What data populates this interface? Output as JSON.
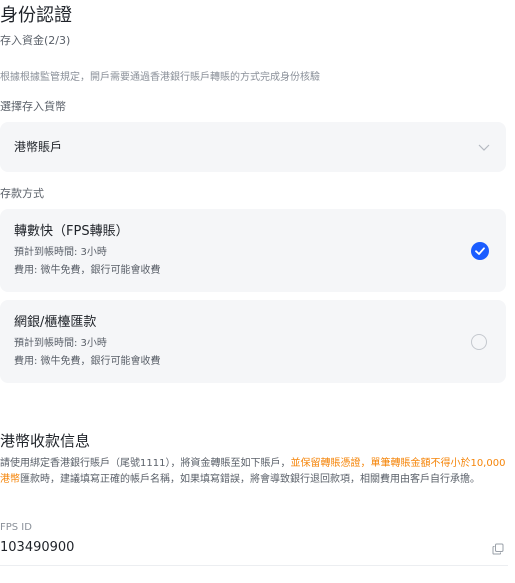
{
  "header": {
    "title": "身份認證",
    "step": "存入資金(2/3)"
  },
  "notice": "根據根據監管規定，開戶需要通過香港銀行賬戶轉賬的方式完成身份核驗",
  "currency": {
    "label": "選擇存入貨幣",
    "selected": "港幣賬戶"
  },
  "deposit_method": {
    "label": "存款方式",
    "options": [
      {
        "title": "轉數快（FPS轉賬）",
        "eta": "預計到帳時間: 3小時",
        "fee": "費用: 微牛免費，銀行可能會收費",
        "selected": true
      },
      {
        "title": "網銀/櫃檯匯款",
        "eta": "預計到帳時間: 3小時",
        "fee": "費用: 微牛免費，銀行可能會收費",
        "selected": false
      }
    ]
  },
  "hk_info": {
    "title": "港幣收款信息",
    "desc_part1": "請使用綁定香港銀行賬戶（尾號1111），將資金轉賬至如下賬戶，",
    "desc_highlight1": "並保留轉賬憑證，單筆轉賬金額不得小於10,000港幣",
    "desc_part2": "匯款時，建議填寫正確的帳戶名稱，如果填寫錯誤，將會導致銀行退回款項，相關費用由客戶自行承擔。"
  },
  "fps": {
    "label": "FPS ID",
    "value": "103490900"
  },
  "colors": {
    "accent": "#1a5cff",
    "highlight": "#f5850a",
    "card_bg": "#f5f6f8"
  },
  "icons": {
    "chevron": "chevron-down-icon",
    "checked": "check-circle-icon",
    "copy": "copy-icon"
  }
}
